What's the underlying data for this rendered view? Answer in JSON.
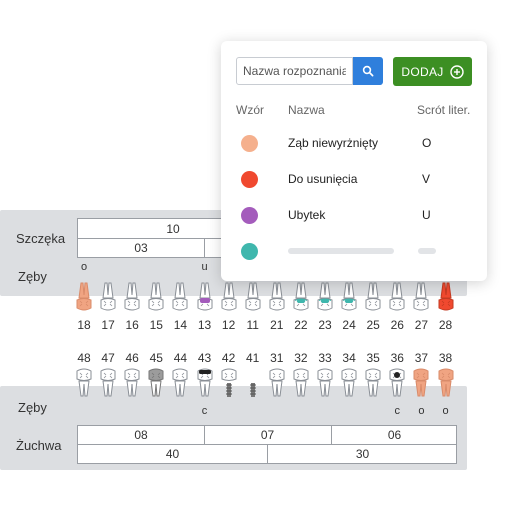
{
  "maxilla": {
    "jaw_label": "Szczęka",
    "teeth_label": "Zęby",
    "segment_top": "10",
    "segment_bottom": "03"
  },
  "upper_teeth": [
    {
      "number": "18",
      "code": "o",
      "status": "unerupted"
    },
    {
      "number": "17",
      "code": "",
      "status": "healthy"
    },
    {
      "number": "16",
      "code": "",
      "status": "healthy"
    },
    {
      "number": "15",
      "code": "",
      "status": "healthy"
    },
    {
      "number": "14",
      "code": "",
      "status": "healthy"
    },
    {
      "number": "13",
      "code": "u",
      "status": "cavity"
    },
    {
      "number": "12",
      "code": "",
      "status": "healthy"
    },
    {
      "number": "11",
      "code": "",
      "status": "healthy"
    },
    {
      "number": "21",
      "code": "",
      "status": "healthy"
    },
    {
      "number": "22",
      "code": "",
      "status": "teal"
    },
    {
      "number": "23",
      "code": "",
      "status": "teal"
    },
    {
      "number": "24",
      "code": "",
      "status": "teal"
    },
    {
      "number": "25",
      "code": "",
      "status": "healthy"
    },
    {
      "number": "26",
      "code": "",
      "status": "healthy"
    },
    {
      "number": "27",
      "code": "",
      "status": "healthy"
    },
    {
      "number": "28",
      "code": "",
      "status": "extract"
    }
  ],
  "lower_teeth": [
    {
      "number": "48",
      "code": "",
      "status": "healthy"
    },
    {
      "number": "47",
      "code": "",
      "status": "healthy"
    },
    {
      "number": "46",
      "code": "",
      "status": "healthy"
    },
    {
      "number": "45",
      "code": "",
      "status": "gray"
    },
    {
      "number": "44",
      "code": "",
      "status": "healthy"
    },
    {
      "number": "43",
      "code": "c",
      "status": "crown-dark"
    },
    {
      "number": "42",
      "code": "",
      "status": "implant"
    },
    {
      "number": "41",
      "code": "",
      "status": "implant-only"
    },
    {
      "number": "31",
      "code": "",
      "status": "healthy"
    },
    {
      "number": "32",
      "code": "",
      "status": "healthy"
    },
    {
      "number": "33",
      "code": "",
      "status": "healthy"
    },
    {
      "number": "34",
      "code": "",
      "status": "healthy"
    },
    {
      "number": "35",
      "code": "",
      "status": "healthy"
    },
    {
      "number": "36",
      "code": "c",
      "status": "crown-dot"
    },
    {
      "number": "37",
      "code": "o",
      "status": "unerupted"
    },
    {
      "number": "38",
      "code": "o",
      "status": "unerupted"
    }
  ],
  "mandible": {
    "teeth_label": "Zęby",
    "jaw_label": "Żuchwa",
    "segments_top": [
      "08",
      "07",
      "06"
    ],
    "segments_bottom": [
      "40",
      "30"
    ]
  },
  "diagnosis_popup": {
    "search_placeholder": "Nazwa rozpoznania",
    "add_label": "DODAJ",
    "headers": {
      "pattern": "Wzór",
      "name": "Nazwa",
      "abbr": "Scrót liter."
    },
    "rows": [
      {
        "color": "#f5b08d",
        "name": "Ząb niewyrżnięty",
        "abbr": "O"
      },
      {
        "color": "#f0492f",
        "name": "Do usunięcia",
        "abbr": "V"
      },
      {
        "color": "#a45cbc",
        "name": "Ubytek",
        "abbr": "U"
      },
      {
        "color": "#3fb7ad",
        "name": "",
        "abbr": ""
      }
    ]
  },
  "colors": {
    "unerupted": "#f0a482",
    "extract": "#f0492f",
    "cavity": "#a45cbc",
    "teal": "#3fb7ad",
    "primary": "#2f7fdc",
    "success": "#3c8f23"
  }
}
